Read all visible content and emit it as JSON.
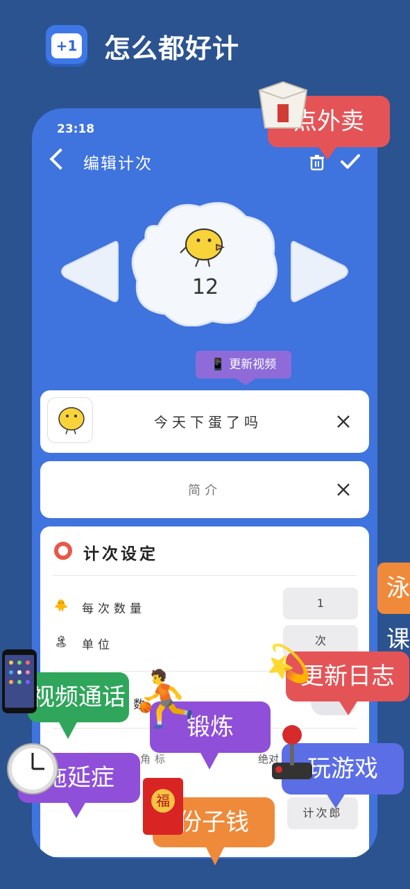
{
  "app": {
    "logo_text": "+1",
    "title": "怎么都好计"
  },
  "status": {
    "time": "23:18"
  },
  "nav": {
    "title": "编辑计次"
  },
  "counter": {
    "value": "12"
  },
  "video_tag": "📱 更新视频",
  "name_field": {
    "value": "今天下蛋了吗"
  },
  "intro_field": {
    "placeholder": "简介"
  },
  "settings": {
    "title": "计次设定",
    "rows": [
      {
        "icon": "🐥",
        "label": "每次数量",
        "value": "1"
      },
      {
        "icon": "🏝",
        "label": "单位",
        "value": "次"
      },
      {
        "label": "数"
      },
      {
        "label": "显示应用角标",
        "value": "绝对"
      },
      {
        "value": "计次郎"
      }
    ]
  },
  "stickers": {
    "takeout": "点外卖",
    "swim": "泳课",
    "changelog": "更新日志",
    "video_call": "视频通话",
    "exercise": "锻炼",
    "procrastinate": "拖延症",
    "games": "玩游戏",
    "red_envelope": "份子钱",
    "fu": "福"
  },
  "colors": {
    "background": "#2b5390",
    "phone": "#3f73de",
    "red_bubble": "#e45457",
    "green_bubble": "#2fa65b",
    "purple_bubble": "#8f4fd9",
    "orange_bubble": "#ef8a3a",
    "blue_bubble": "#5b6ee6"
  }
}
